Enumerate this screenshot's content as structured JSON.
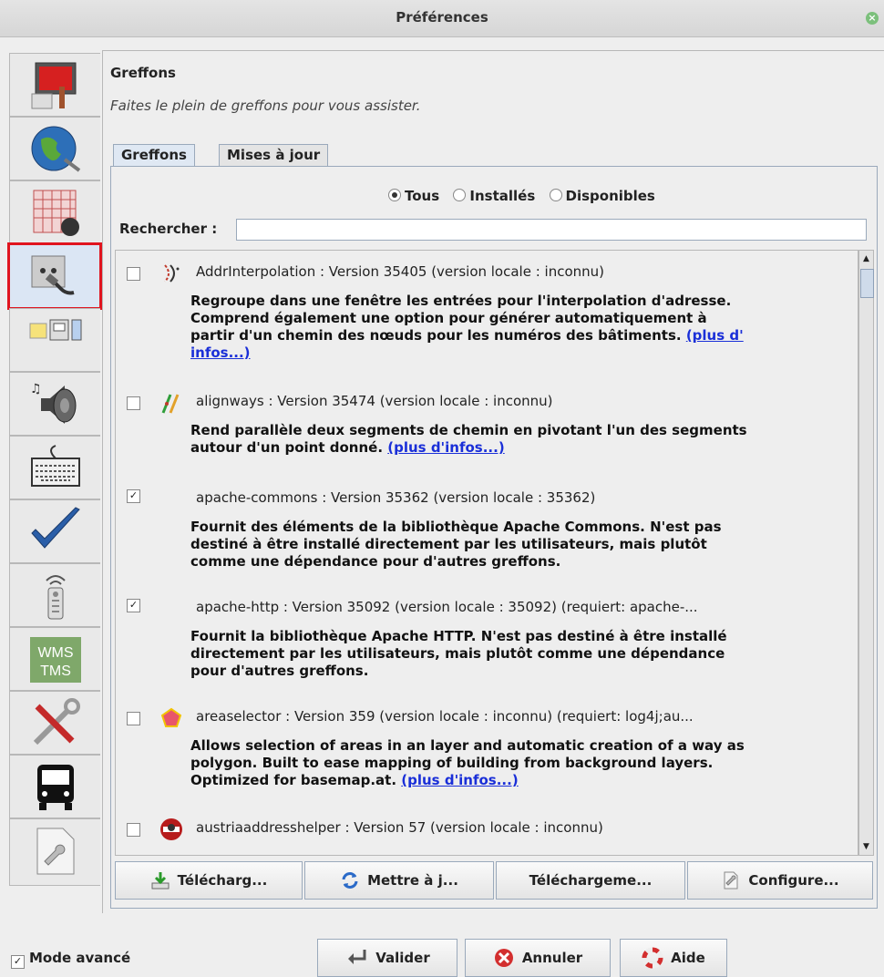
{
  "window": {
    "title": "Préférences"
  },
  "panel": {
    "title": "Greffons",
    "subtitle": "Faites le plein de greffons pour vous assister."
  },
  "tabs": [
    {
      "label": "Greffons",
      "selected": true
    },
    {
      "label": "Mises à jour",
      "selected": false
    }
  ],
  "filters": {
    "options": [
      "Tous",
      "Installés",
      "Disponibles"
    ],
    "selected": "Tous"
  },
  "search": {
    "label": "Rechercher :",
    "value": ""
  },
  "plugins": [
    {
      "name": "AddrInterpolation : Version 35405 (version locale : inconnu)",
      "checked": false,
      "desc": [
        "Regroupe dans une fenêtre les entrées pour l'interpolation d'adresse.",
        "Comprend également une option pour générer automatiquement à",
        "partir d'un chemin des nœuds pour les numéros des bâtiments."
      ],
      "more1": "(plus d'",
      "more2": "infos...)"
    },
    {
      "name": "alignways : Version 35474 (version locale : inconnu)",
      "checked": false,
      "desc": [
        "Rend parallèle deux segments de chemin en pivotant l'un des segments",
        "autour d'un point donné."
      ],
      "more": "(plus d'infos...)"
    },
    {
      "name": "apache-commons : Version 35362 (version locale : 35362)",
      "checked": true,
      "desc": [
        "Fournit des éléments de la bibliothèque Apache Commons. N'est pas",
        "destiné à être installé directement par les utilisateurs, mais plutôt",
        "comme une dépendance pour d'autres greffons."
      ]
    },
    {
      "name": "apache-http : Version 35092 (version locale : 35092) (requiert: apache-...",
      "checked": true,
      "desc": [
        "Fournit la bibliothèque Apache HTTP. N'est pas destiné à être installé",
        "directement par les utilisateurs, mais plutôt comme une dépendance",
        "pour d'autres greffons."
      ]
    },
    {
      "name": "areaselector : Version 359 (version locale : inconnu) (requiert: log4j;au...",
      "checked": false,
      "desc": [
        "Allows selection of areas in an layer and automatic creation of a way as",
        "polygon. Built to ease mapping of building from background layers.",
        "Optimized for basemap.at."
      ],
      "more": "(plus d'infos...)"
    },
    {
      "name": "austriaaddresshelper : Version 57 (version locale : inconnu)",
      "checked": false
    }
  ],
  "actions": [
    "Télécharg...",
    "Mettre à j...",
    "Téléchargeme...",
    "Configure..."
  ],
  "footer": {
    "mode_label": "Mode avancé",
    "mode_checked": true,
    "ok": "Valider",
    "cancel": "Annuler",
    "help": "Aide"
  },
  "wms_text": [
    "WMS",
    "TMS"
  ]
}
